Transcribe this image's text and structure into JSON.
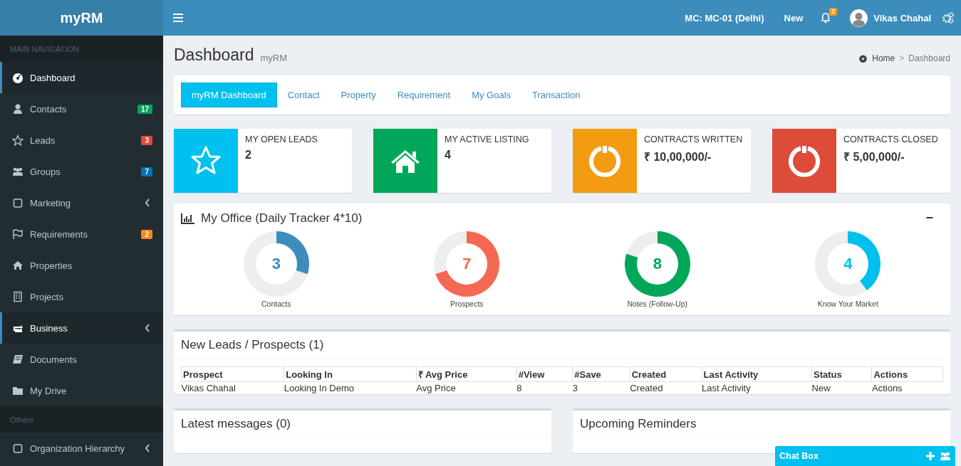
{
  "header": {
    "logo": "myRM",
    "branch": "MC: MC-01 (Delhi)",
    "new_link": "New",
    "notification_count": "2",
    "user_name": "Vikas Chahal"
  },
  "sidebar": {
    "sections": [
      {
        "header": "MAIN NAVIGATION",
        "items": [
          {
            "label": "Dashboard",
            "selected": true,
            "kind": "link"
          },
          {
            "label": "Contacts",
            "selected": false,
            "kind": "link",
            "badge": "17",
            "color": "#00a65a"
          },
          {
            "label": "Leads",
            "selected": false,
            "kind": "link",
            "badge": "3",
            "color": "#dd4b39"
          },
          {
            "label": "Groups",
            "selected": false,
            "kind": "link",
            "badge": "7",
            "color": "#0073b7"
          },
          {
            "label": "Marketing",
            "selected": false,
            "kind": "submenu"
          },
          {
            "label": "Requirements",
            "selected": false,
            "kind": "link",
            "badge": "2",
            "color": "#ff851b"
          },
          {
            "label": "Properties",
            "selected": false,
            "kind": "link"
          },
          {
            "label": "Projects",
            "selected": false,
            "kind": "link"
          },
          {
            "label": "Business",
            "selected": true,
            "kind": "submenu"
          },
          {
            "label": "Documents",
            "selected": false,
            "kind": "link"
          },
          {
            "label": "My Drive",
            "selected": false,
            "kind": "link"
          }
        ]
      },
      {
        "header": "Others",
        "items": [
          {
            "label": "Organization Hierarchy",
            "selected": false,
            "kind": "submenu"
          }
        ]
      }
    ]
  },
  "page": {
    "title": "Dashboard",
    "subtitle": "myRM",
    "breadcrumb": [
      "Home",
      ">",
      "Dashboard"
    ]
  },
  "tabs": [
    {
      "label": "myRM Dashboard",
      "selected": true
    },
    {
      "label": "Contact",
      "selected": false
    },
    {
      "label": "Property",
      "selected": false
    },
    {
      "label": "Requirement",
      "selected": false
    },
    {
      "label": "My Goals",
      "selected": false
    },
    {
      "label": "Transaction",
      "selected": false
    }
  ],
  "info_boxes": [
    {
      "label": "MY OPEN LEADS",
      "value": "2",
      "color": "#00c0ef",
      "kind": "star"
    },
    {
      "label": "MY ACTIVE LISTING",
      "value": "4",
      "color": "#00a65a",
      "kind": "home"
    },
    {
      "label": "CONTRACTS WRITTEN",
      "value": "₹ 10,00,000/-",
      "color": "#f39c12",
      "kind": "power"
    },
    {
      "label": "CONTRACTS CLOSED",
      "value": "₹ 5,00,000/-",
      "color": "#dd4b39",
      "kind": "power"
    }
  ],
  "office": {
    "title": "My Office (Daily Tracker 4*10)",
    "collapse": "−",
    "gauges": [
      {
        "value": "3",
        "label": "Contacts",
        "color": "#3c8dbc"
      },
      {
        "value": "7",
        "label": "Prospects",
        "color": "#f56954"
      },
      {
        "value": "8",
        "label": "Notes (Follow-Up)",
        "color": "#00a65a"
      },
      {
        "value": "4",
        "label": "Know Your Market",
        "color": "#00c0ef"
      }
    ]
  },
  "leads": {
    "title": "New Leads / Prospects (1)",
    "columns": [
      "Prospect",
      "Looking In",
      "₹ Avg Price",
      "#View",
      "#Save",
      "Created",
      "Last Activity",
      "Status",
      "Actions"
    ],
    "rows": [
      [
        "Vikas Chahal",
        "Looking In Demo",
        "Avg Price",
        "8",
        "3",
        "Created",
        "Last Activity",
        "New",
        "Actions"
      ]
    ]
  },
  "messages": {
    "title": "Latest messages (0)"
  },
  "reminders": {
    "title": "Upcoming Reminders"
  },
  "chat": {
    "title": "Chat Box"
  }
}
